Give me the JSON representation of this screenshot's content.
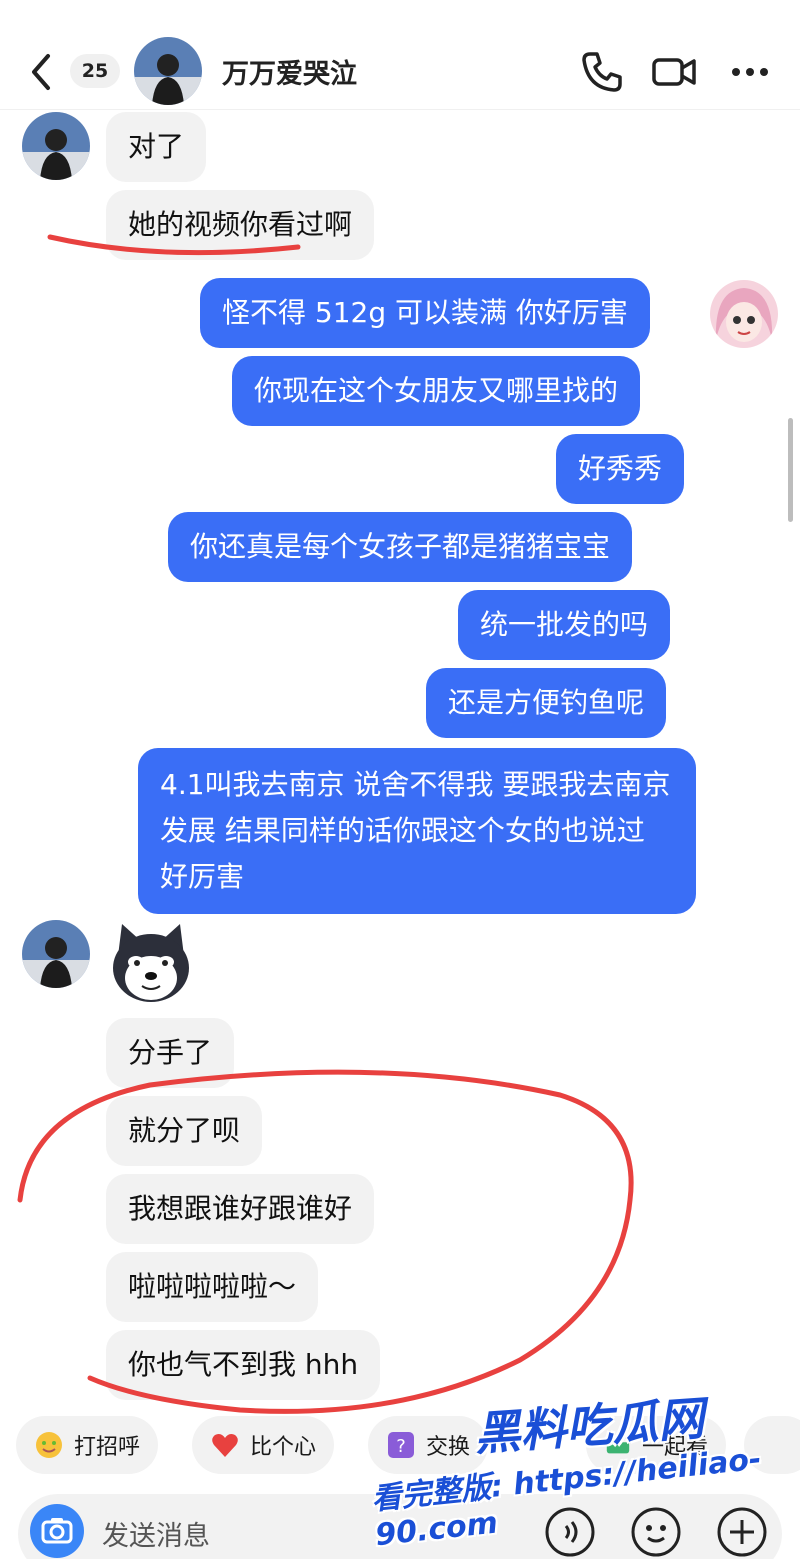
{
  "header": {
    "unread_count": "25",
    "contact_name": "万万爱哭泣"
  },
  "messages": {
    "m1": "对了",
    "m2": "她的视频你看过啊",
    "m3": "怪不得 512g 可以装满 你好厉害",
    "m4": "你现在这个女朋友又哪里找的",
    "m5": "好秀秀",
    "m6": "你还真是每个女孩子都是猪猪宝宝",
    "m7": "统一批发的吗",
    "m8": "还是方便钓鱼呢",
    "m9": "4.1叫我去南京 说舍不得我 要跟我去南京发展 结果同样的话你跟这个女的也说过 好厉害",
    "m10": "分手了",
    "m11": "就分了呗",
    "m12": "我想跟谁好跟谁好",
    "m13": "啦啦啦啦啦～",
    "m14": "你也气不到我 hhh"
  },
  "quick_replies": {
    "q1": "打招呼",
    "q2": "比个心",
    "q3": "交换",
    "q4": "一起看"
  },
  "input": {
    "placeholder": "发送消息"
  },
  "watermark": {
    "brand": "黑料吃瓜网",
    "url_text": "看完整版: https://heiliao-90.com"
  },
  "colors": {
    "outgoing_bubble": "#3a6ef6",
    "incoming_bubble": "#f2f2f2",
    "annotation": "#e8413f"
  }
}
